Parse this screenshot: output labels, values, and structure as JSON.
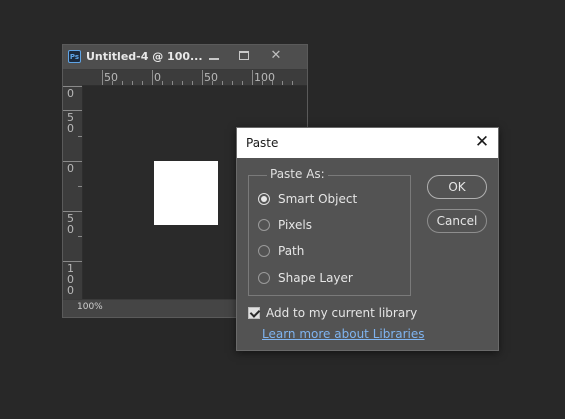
{
  "document_window": {
    "title": "Untitled-4 @ 100...",
    "app_icon": "ps-icon",
    "ruler_top_labels": [
      "50",
      "0",
      "50",
      "100"
    ],
    "ruler_left_labels": [
      "0",
      "5",
      "0",
      "0",
      "5",
      "0",
      "1",
      "0",
      "0"
    ],
    "zoom": "100%"
  },
  "paste_dialog": {
    "title": "Paste",
    "group_label": "Paste As:",
    "options": [
      {
        "label": "Smart Object",
        "selected": true
      },
      {
        "label": "Pixels",
        "selected": false
      },
      {
        "label": "Path",
        "selected": false
      },
      {
        "label": "Shape Layer",
        "selected": false
      }
    ],
    "ok_label": "OK",
    "cancel_label": "Cancel",
    "checkbox_label": "Add to my current library",
    "checkbox_checked": true,
    "link_text": "Learn more about Libraries"
  },
  "colors": {
    "background": "#282828",
    "dialog_bg": "#535353",
    "link": "#7fb4f0"
  }
}
